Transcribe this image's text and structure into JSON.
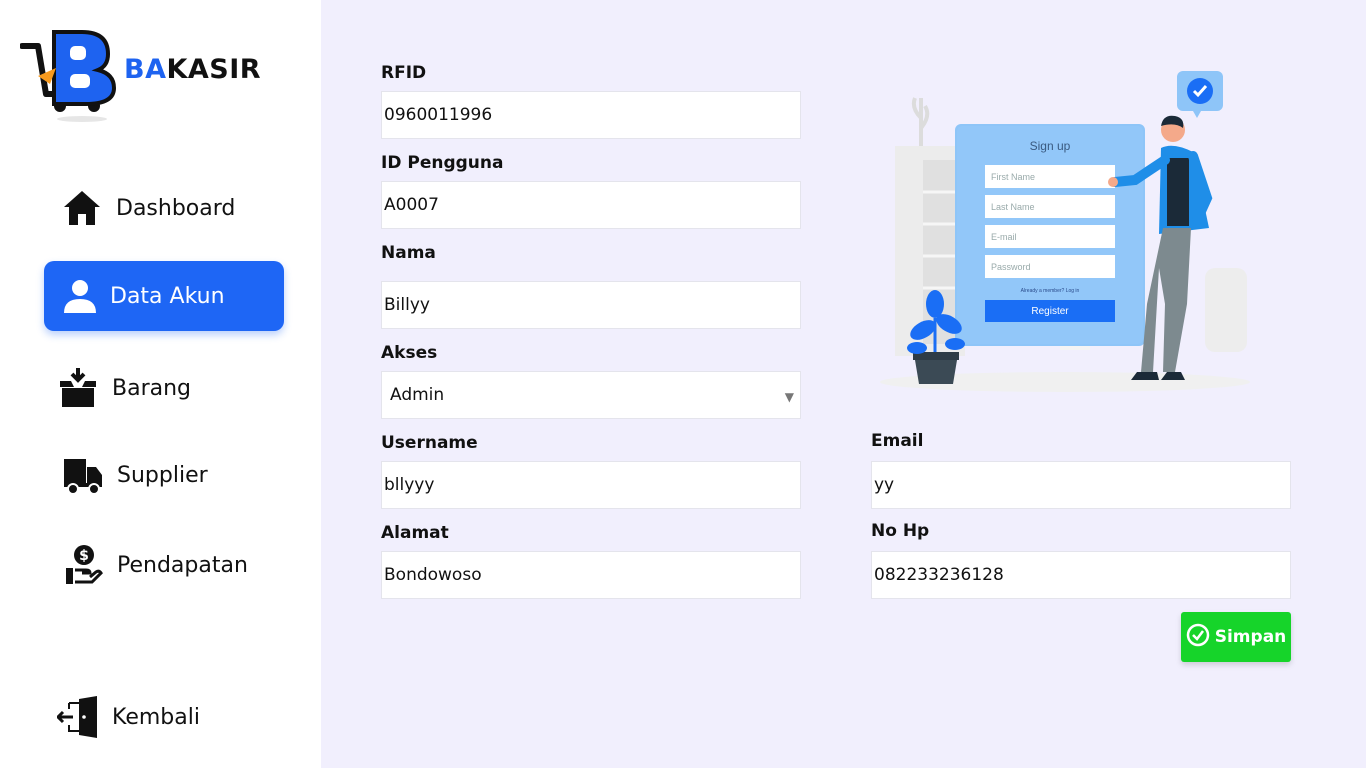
{
  "brand": {
    "part1": "BA",
    "part2": "KASIR"
  },
  "nav": {
    "dashboard": "Dashboard",
    "data_akun": "Data Akun",
    "barang": "Barang",
    "supplier": "Supplier",
    "pendapatan": "Pendapatan",
    "kembali": "Kembali"
  },
  "form": {
    "rfid": {
      "label": "RFID",
      "value": "0960011996"
    },
    "id_pengguna": {
      "label": "ID Pengguna",
      "value": "A0007"
    },
    "nama": {
      "label": "Nama",
      "value": "Billyy"
    },
    "akses": {
      "label": "Akses",
      "value": "Admin"
    },
    "username": {
      "label": "Username",
      "value": "bllyyy"
    },
    "alamat": {
      "label": "Alamat",
      "value": "Bondowoso"
    },
    "email": {
      "label": "Email",
      "value": "yy"
    },
    "no_hp": {
      "label": "No Hp",
      "value": "082233236128"
    }
  },
  "save_label": "Simpan",
  "illustration": {
    "title": "Sign up",
    "fields": [
      "First Name",
      "Last Name",
      "E-mail",
      "Password"
    ],
    "member_text": "Already a member? Log in",
    "button": "Register"
  },
  "colors": {
    "accent": "#1e66f5",
    "save": "#16d42a",
    "background": "#f1effd"
  }
}
